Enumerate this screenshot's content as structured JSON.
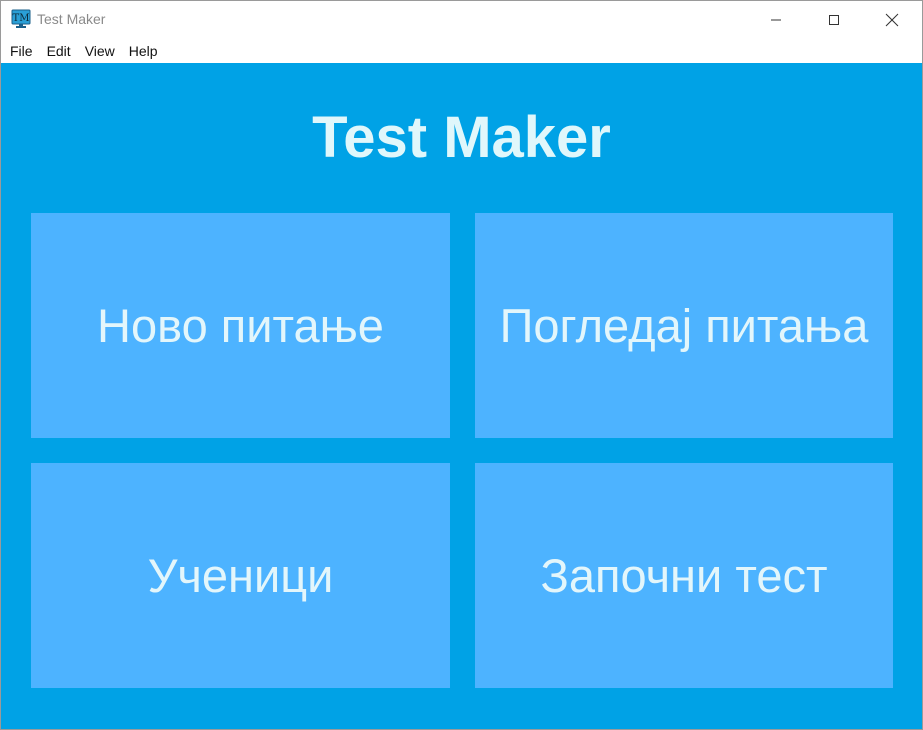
{
  "window": {
    "title": "Test Maker",
    "app_icon": "tm-monitor-icon",
    "controls": [
      "minimize-icon",
      "maximize-icon",
      "close-icon"
    ]
  },
  "menubar": {
    "items": [
      {
        "label": "File"
      },
      {
        "label": "Edit"
      },
      {
        "label": "View"
      },
      {
        "label": "Help"
      }
    ]
  },
  "main": {
    "heading": "Test Maker",
    "tiles": [
      {
        "label": "Ново питање"
      },
      {
        "label": "Погледај питања"
      },
      {
        "label": "Ученици"
      },
      {
        "label": "Започни тест"
      }
    ]
  },
  "colors": {
    "background": "#00a2e6",
    "tile": "#4db3ff",
    "text": "#e0f7fb"
  }
}
